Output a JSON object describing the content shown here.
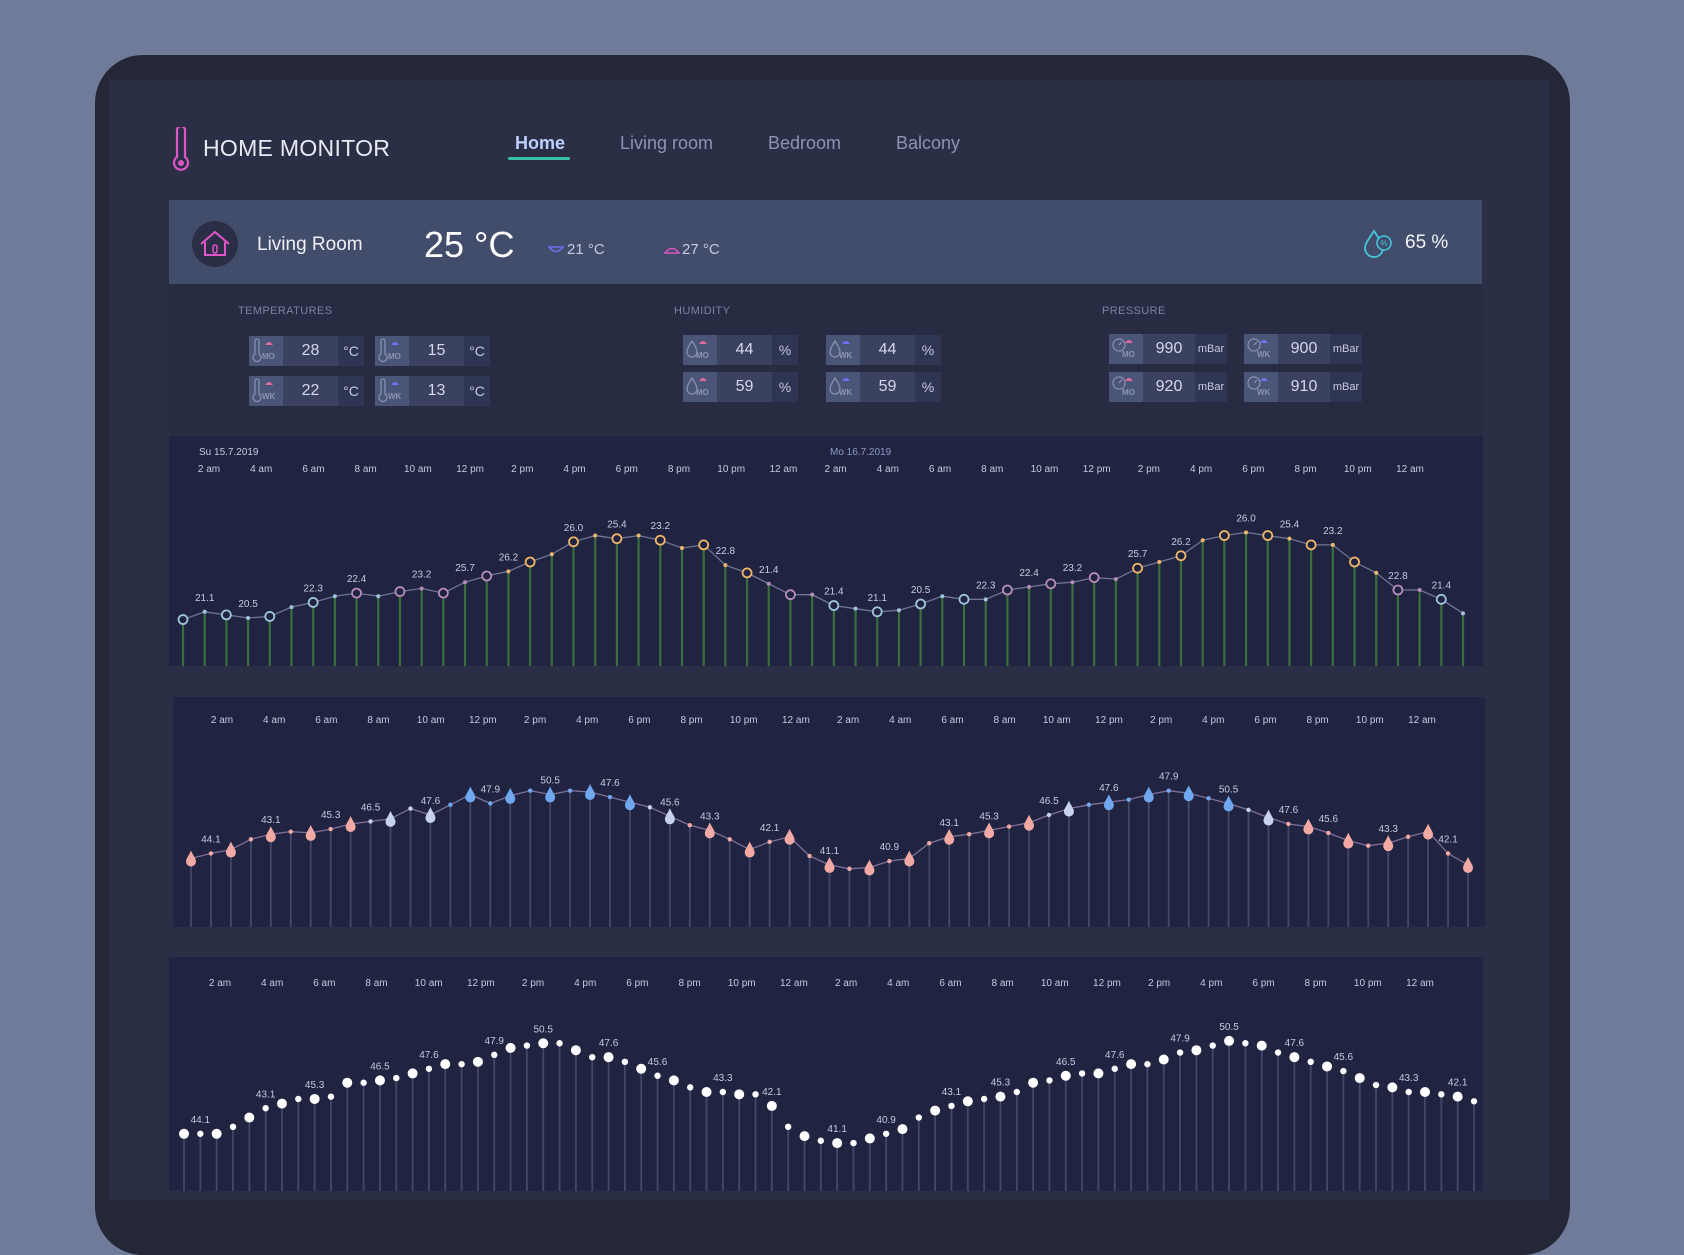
{
  "app": {
    "title": "HOME MONITOR"
  },
  "nav": {
    "items": [
      {
        "label": "Home",
        "active": true
      },
      {
        "label": "Living room",
        "active": false
      },
      {
        "label": "Bedroom",
        "active": false
      },
      {
        "label": "Balcony",
        "active": false
      }
    ]
  },
  "room": {
    "name": "Living Room",
    "temperature": "25 °C",
    "min_temp": "21 °C",
    "max_temp": "27 °C",
    "humidity": "65 %"
  },
  "stats": {
    "temperatures": {
      "label": "TEMPERATURES",
      "unit": "°C",
      "values": [
        {
          "tag": "MO",
          "value": "28"
        },
        {
          "tag": "MO",
          "value": "15"
        },
        {
          "tag": "WK",
          "value": "22"
        },
        {
          "tag": "WK",
          "value": "13"
        }
      ]
    },
    "humidity": {
      "label": "HUMIDITY",
      "unit": "%",
      "values": [
        {
          "tag": "MO",
          "value": "44"
        },
        {
          "tag": "WK",
          "value": "44"
        },
        {
          "tag": "MO",
          "value": "59"
        },
        {
          "tag": "WK",
          "value": "59"
        }
      ]
    },
    "pressure": {
      "label": "PRESSURE",
      "unit": "mBar",
      "values": [
        {
          "tag": "MO",
          "value": "990"
        },
        {
          "tag": "WK",
          "value": "900"
        },
        {
          "tag": "MO",
          "value": "920"
        },
        {
          "tag": "WK",
          "value": "910"
        }
      ]
    }
  },
  "colors": {
    "accent": "#35c2a9",
    "warm": "#f0b66a",
    "cool": "#9fc4dd",
    "rose": "#f2a9a4",
    "drop_blue": "#6fa8ef",
    "logo": "#e055c9"
  },
  "chart_data": [
    {
      "type": "line",
      "dates": [
        "Su 15.7.2019",
        "Mo 16.7.2019"
      ],
      "x_ticks": [
        "2 am",
        "4 am",
        "6 am",
        "8 am",
        "10 am",
        "12 pm",
        "2 pm",
        "4 pm",
        "6 pm",
        "8 pm",
        "10 pm",
        "12 am",
        "2 am",
        "4 am",
        "6 am",
        "8 am",
        "10 am",
        "12 pm",
        "2 pm",
        "4 pm",
        "6 pm",
        "8 pm",
        "10 pm",
        "12 am"
      ],
      "series": [
        {
          "values": [
            20.6,
            21.1,
            20.9,
            20.7,
            20.8,
            21.4,
            21.7,
            22.1,
            22.3,
            22.1,
            22.4,
            22.6,
            22.3,
            23.0,
            23.4,
            23.7,
            24.3,
            24.8,
            25.6,
            26.0,
            25.8,
            26.0,
            25.7,
            25.2,
            25.4,
            24.1,
            23.6,
            22.9,
            22.2,
            22.2,
            21.5,
            21.3,
            21.1,
            21.2,
            21.6,
            22.1,
            21.9,
            21.9,
            22.5,
            22.7,
            22.9,
            23.0,
            23.3,
            23.2,
            23.9,
            24.3,
            24.7,
            25.7,
            26.0,
            26.2,
            26.0,
            25.8,
            25.4,
            25.4,
            24.3,
            23.6,
            22.5,
            22.5,
            21.9,
            21.0
          ]
        }
      ],
      "data_labels": [
        "21.1",
        "20.5",
        "22.3",
        "22.4",
        "23.2",
        "25.7",
        "26.2",
        "26.0",
        "25.4",
        "23.2",
        "22.8",
        "21.4",
        "21.4",
        "21.1",
        "20.5",
        "22.3",
        "22.4",
        "23.2",
        "25.7",
        "26.2",
        "26.0",
        "25.4",
        "23.2",
        "22.8",
        "21.4"
      ]
    },
    {
      "type": "line",
      "x_ticks": [
        "2 am",
        "4 am",
        "6 am",
        "8 am",
        "10 am",
        "12 pm",
        "2 pm",
        "4 pm",
        "6 pm",
        "8 pm",
        "10 pm",
        "12 am",
        "2 am",
        "4 am",
        "6 am",
        "8 am",
        "10 am",
        "12 pm",
        "2 pm",
        "4 pm",
        "6 pm",
        "8 pm",
        "10 pm",
        "12 am"
      ],
      "series": [
        {
          "values": [
            42.6,
            43.0,
            43.3,
            44.1,
            44.5,
            44.7,
            44.6,
            44.9,
            45.3,
            45.5,
            45.7,
            46.5,
            46.0,
            46.8,
            47.6,
            46.9,
            47.5,
            47.9,
            47.6,
            47.9,
            47.8,
            47.4,
            47.0,
            46.6,
            45.9,
            45.2,
            44.8,
            44.1,
            43.3,
            43.9,
            44.3,
            42.8,
            42.1,
            41.8,
            41.9,
            42.4,
            42.6,
            43.8,
            44.3,
            44.5,
            44.8,
            45.1,
            45.4,
            46.0,
            46.5,
            46.8,
            47.0,
            47.2,
            47.6,
            47.9,
            47.7,
            47.3,
            46.9,
            46.4,
            45.8,
            45.3,
            45.1,
            44.6,
            44.0,
            43.6,
            43.8,
            44.3,
            44.7,
            43.0,
            42.1
          ]
        }
      ],
      "data_labels": [
        "44.1",
        "43.1",
        "45.3",
        "46.5",
        "47.6",
        "47.9",
        "50.5",
        "47.6",
        "45.6",
        "43.3",
        "42.1",
        "41.1",
        "40.9",
        "43.1",
        "45.3",
        "46.5",
        "47.6",
        "47.9",
        "50.5",
        "47.6",
        "45.6",
        "43.3",
        "42.1"
      ]
    },
    {
      "type": "scatter",
      "x_ticks": [
        "2 am",
        "4 am",
        "6 am",
        "8 am",
        "10 am",
        "12 pm",
        "2 pm",
        "4 pm",
        "6 pm",
        "8 pm",
        "10 pm",
        "12 am",
        "2 am",
        "4 am",
        "6 am",
        "8 am",
        "10 am",
        "12 pm",
        "2 pm",
        "4 pm",
        "6 pm",
        "8 pm",
        "10 pm",
        "12 am"
      ],
      "series": [
        {
          "values": [
            42.0,
            42.0,
            42.0,
            42.3,
            42.7,
            43.1,
            43.3,
            43.5,
            43.5,
            43.6,
            44.2,
            44.2,
            44.3,
            44.4,
            44.6,
            44.8,
            45.0,
            45.0,
            45.1,
            45.4,
            45.7,
            45.8,
            45.9,
            45.9,
            45.6,
            45.3,
            45.3,
            45.1,
            44.8,
            44.5,
            44.3,
            44.0,
            43.8,
            43.8,
            43.7,
            43.7,
            43.2,
            42.3,
            41.9,
            41.7,
            41.6,
            41.6,
            41.8,
            42.0,
            42.2,
            42.7,
            43.0,
            43.2,
            43.4,
            43.5,
            43.6,
            43.8,
            44.2,
            44.3,
            44.5,
            44.6,
            44.6,
            44.8,
            45.0,
            45.0,
            45.2,
            45.5,
            45.6,
            45.8,
            46.0,
            45.9,
            45.8,
            45.5,
            45.3,
            45.1,
            44.9,
            44.7,
            44.4,
            44.1,
            44.0,
            43.8,
            43.8,
            43.7,
            43.6,
            43.4
          ]
        }
      ],
      "data_labels": [
        "44.1",
        "43.1",
        "45.3",
        "46.5",
        "47.6",
        "47.9",
        "50.5",
        "47.6",
        "45.6",
        "43.3",
        "42.1",
        "41.1",
        "40.9",
        "43.1",
        "45.3",
        "46.5",
        "47.6",
        "47.9",
        "50.5",
        "47.6",
        "45.6",
        "43.3",
        "42.1"
      ]
    }
  ]
}
